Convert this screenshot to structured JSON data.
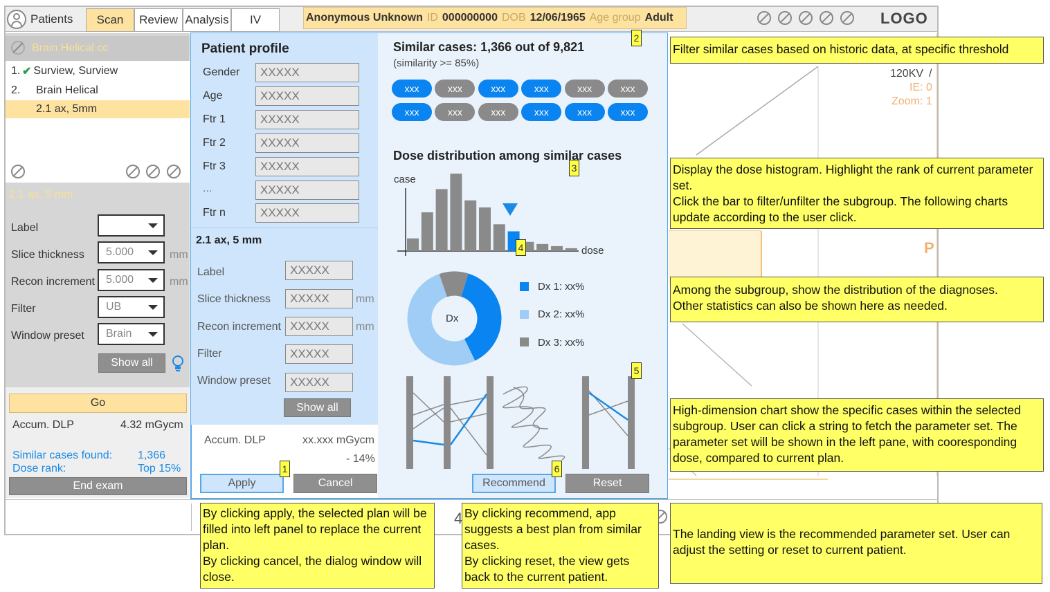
{
  "topbar": {
    "patients_label": "Patients",
    "tabs": [
      {
        "label": "Scan"
      },
      {
        "label": "Review"
      },
      {
        "label": "Analysis"
      },
      {
        "label": "IV"
      }
    ],
    "patient_name": "Anonymous Unknown",
    "id_label": "ID",
    "id_value": "000000000",
    "dob_label": "DOB",
    "dob_value": "12/06/1965",
    "age_label": "Age group",
    "age_value": "Adult",
    "logo": "LOGO"
  },
  "left": {
    "selected": "Brain Helical cc",
    "tree": [
      {
        "num": "1.",
        "label": "Surview, Surview"
      },
      {
        "num": "2.",
        "label": "Brain Helical"
      },
      {
        "num": "",
        "label": "2.1 ax, 5mm"
      }
    ],
    "section_title": "2.1 ax, 5 mm",
    "fields": [
      {
        "label": "Label",
        "value": "",
        "unit": ""
      },
      {
        "label": "Slice thickness",
        "value": "5.000",
        "unit": "mm"
      },
      {
        "label": "Recon increment",
        "value": "5.000",
        "unit": "mm"
      },
      {
        "label": "Filter",
        "value": "UB",
        "unit": ""
      },
      {
        "label": "Window preset",
        "value": "Brain",
        "unit": ""
      }
    ],
    "show_all": "Show all",
    "go": "Go",
    "accum_label": "Accum. DLP",
    "accum_value": "4.32 mGycm",
    "similar_label": "Similar cases found:",
    "similar_value": "1,366",
    "rank_label": "Dose rank:",
    "rank_value": "Top 15%",
    "end_exam": "End exam"
  },
  "viewer": {
    "kv": "120KV",
    "slash": "/",
    "ie": "IE: 0",
    "zoom": "Zoom: 1",
    "p": "P",
    "four": "4"
  },
  "dialog": {
    "profile_title": "Patient profile",
    "profile": [
      {
        "label": "Gender",
        "value": "XXXXX"
      },
      {
        "label": "Age",
        "value": "XXXXX"
      },
      {
        "label": "Ftr 1",
        "value": "XXXXX"
      },
      {
        "label": "Ftr 2",
        "value": "XXXXX"
      },
      {
        "label": "Ftr 3",
        "value": "XXXXX"
      },
      {
        "label": "...",
        "value": "XXXXX"
      },
      {
        "label": "Ftr n",
        "value": "XXXXX"
      }
    ],
    "section_title": "2.1 ax, 5 mm",
    "params": [
      {
        "label": "Label",
        "value": "XXXXX",
        "unit": ""
      },
      {
        "label": "Slice thickness",
        "value": "XXXXX",
        "unit": "mm"
      },
      {
        "label": "Recon increment",
        "value": "XXXXX",
        "unit": "mm"
      },
      {
        "label": "Filter",
        "value": "XXXXX",
        "unit": ""
      },
      {
        "label": "Window preset",
        "value": "XXXXX",
        "unit": ""
      }
    ],
    "show_all": "Show all",
    "accum_label": "Accum. DLP",
    "accum_value": "xx.xxx mGycm",
    "accum_delta": "- 14%",
    "apply": "Apply",
    "cancel": "Cancel",
    "similar_title": "Similar cases: 1,366 out of 9,821",
    "similar_sub": "(similarity >= 85%)",
    "pills": [
      {
        "label": "xxx",
        "state": "on"
      },
      {
        "label": "xxx",
        "state": "off"
      },
      {
        "label": "xxx",
        "state": "on"
      },
      {
        "label": "xxx",
        "state": "on"
      },
      {
        "label": "xxx",
        "state": "off"
      },
      {
        "label": "xxx",
        "state": "off"
      },
      {
        "label": "xxx",
        "state": "on"
      },
      {
        "label": "xxx",
        "state": "off"
      },
      {
        "label": "xxx",
        "state": "off"
      },
      {
        "label": "xxx",
        "state": "on"
      },
      {
        "label": "xxx",
        "state": "on"
      },
      {
        "label": "xxx",
        "state": "on"
      }
    ],
    "dose_title": "Dose distribution among similar cases",
    "donut_center": "Dx",
    "legend": [
      {
        "label": "Dx 1: xx%",
        "color": "#0a84f0"
      },
      {
        "label": "Dx 2: xx%",
        "color": "#9fcdf5"
      },
      {
        "label": "Dx 3: xx%",
        "color": "#8a8a8a"
      }
    ],
    "recommend": "Recommend",
    "reset": "Reset",
    "badges": [
      "1",
      "2",
      "3",
      "4",
      "5",
      "6"
    ]
  },
  "chart_data": {
    "type": "bar",
    "title": "",
    "xlabel": "dose",
    "ylabel": "case",
    "values": [
      18,
      55,
      88,
      110,
      72,
      62,
      38,
      28,
      13,
      10,
      7,
      4
    ],
    "highlight_index": 7,
    "marker": "current plan rank"
  },
  "donut": [
    {
      "label": "Dx 1",
      "fraction": 0.38,
      "color": "#0a84f0"
    },
    {
      "label": "Dx 2",
      "fraction": 0.52,
      "color": "#9fcdf5"
    },
    {
      "label": "Dx 3",
      "fraction": 0.1,
      "color": "#8a8a8a"
    }
  ],
  "notes": [
    "Filter similar cases based on historic data, at specific threshold",
    "Display the dose histogram. Highlight the rank of current parameter set.\nClick the bar to filter/unfilter the subgroup. The following charts update according to the user click.",
    "Among the subgroup, show the distribution of the diagnoses.\nOther statistics can also be shown here as needed.",
    "High-dimension chart show the specific cases within the selected subgroup. User can click a string to fetch the parameter set. The parameter set will be shown in the left pane, with cooresponding dose, compared to current plan.",
    "By clicking apply, the selected plan will be filled into left panel to replace the current plan.\nBy clicking cancel, the dialog window will close.",
    "By clicking recommend, app suggests a best plan from similar cases.\nBy clicking reset, the view gets back to the current patient.",
    "The landing view is the recommended parameter set. User can adjust the setting or reset to current patient."
  ]
}
